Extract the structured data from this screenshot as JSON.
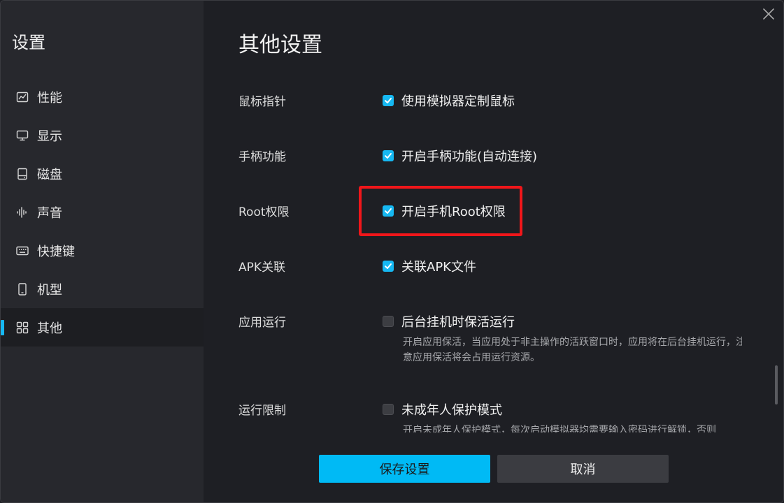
{
  "sidebar": {
    "title": "设置",
    "items": [
      {
        "label": "性能",
        "icon": "performance-chart-icon"
      },
      {
        "label": "显示",
        "icon": "monitor-icon"
      },
      {
        "label": "磁盘",
        "icon": "disk-icon"
      },
      {
        "label": "声音",
        "icon": "sound-wave-icon"
      },
      {
        "label": "快捷键",
        "icon": "keyboard-icon"
      },
      {
        "label": "机型",
        "icon": "phone-icon"
      },
      {
        "label": "其他",
        "icon": "grid-icon",
        "active": true
      }
    ]
  },
  "main": {
    "title": "其他设置",
    "settings": [
      {
        "label": "鼠标指针",
        "option": "使用模拟器定制鼠标",
        "checked": true
      },
      {
        "label": "手柄功能",
        "option": "开启手柄功能(自动连接)",
        "checked": true
      },
      {
        "label": "Root权限",
        "option": "开启手机Root权限",
        "checked": true
      },
      {
        "label": "APK关联",
        "option": "关联APK文件",
        "checked": true
      },
      {
        "label": "应用运行",
        "option": "后台挂机时保活运行",
        "checked": false,
        "description": "开启应用保活，当应用处于非主操作的活跃窗口时，应用将在后台挂机运行，注意应用保活将会占用运行资源。"
      },
      {
        "label": "运行限制",
        "option": "未成年人保护模式",
        "checked": false,
        "description": "开启未成年人保护模式，每次启动模拟器均需要输入密码进行解锁，否则"
      }
    ]
  },
  "buttons": {
    "save": "保存设置",
    "cancel": "取消"
  },
  "colors": {
    "accent": "#16b8f2",
    "highlight": "#f0161a"
  }
}
